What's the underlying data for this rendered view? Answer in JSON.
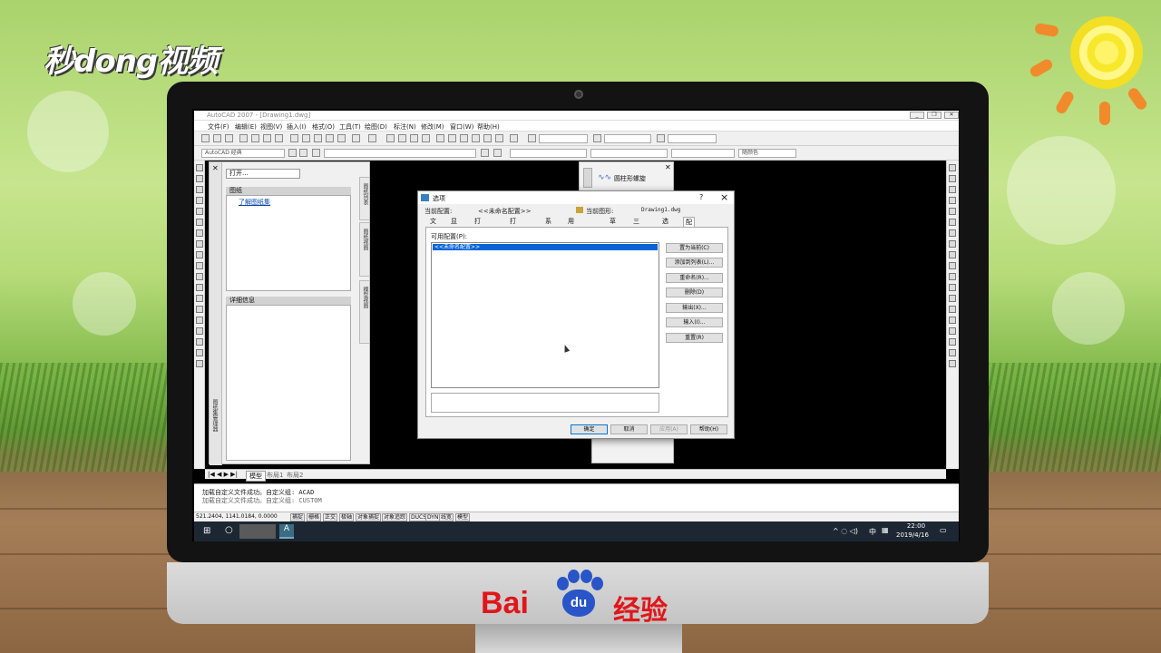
{
  "overlay": {
    "logo": "秒dong视频",
    "brand_en": "Bai",
    "brand_du": "du",
    "brand_cn": "经验"
  },
  "app": {
    "title": "AutoCAD 2007 - [Drawing1.dwg]",
    "menu": [
      "文件(F)",
      "编辑(E)",
      "视图(V)",
      "插入(I)",
      "格式(O)",
      "工具(T)",
      "绘图(D)",
      "标注(N)",
      "修改(M)",
      "窗口(W)",
      "帮助(H)"
    ],
    "workspace": "AutoCAD 经典",
    "bylayer_color": "随颜色"
  },
  "sheetset": {
    "open_combo": "打开...",
    "section1": "图纸",
    "link": "了解图纸集",
    "section2": "详细信息",
    "tab_list": "图纸列表",
    "tab_views": "图纸视图",
    "tab_model": "模型视图",
    "vertical_title": "图纸集管理器"
  },
  "tool_palette": {
    "item": "圆柱形螺旋"
  },
  "layout_tabs": [
    "模型",
    "布局1",
    "布局2"
  ],
  "command_line": {
    "line1": "加载自定义文件成功。自定义组: ACAD",
    "line2": "加载自定义文件成功。自定义组: CUSTOM"
  },
  "status": {
    "coords": "521.2404,  1141.0184, 0.0000",
    "toggles": [
      "捕捉",
      "栅格",
      "正交",
      "极轴",
      "对象捕捉",
      "对象追踪",
      "DUCS",
      "DYN",
      "线宽",
      "模型"
    ]
  },
  "taskbar": {
    "time": "22:00",
    "date": "2019/4/16",
    "ime": "中"
  },
  "dialog": {
    "title": "选项",
    "current_profile_label": "当前配置:",
    "current_profile_value": "<<未命名配置>>",
    "current_drawing_label": "当前图形:",
    "current_drawing_value": "Drawing1.dwg",
    "tabs": [
      "文件",
      "显示",
      "打开和保存",
      "打印和发布",
      "系统",
      "用户系统配置",
      "草图",
      "三维建模",
      "选择",
      "配置"
    ],
    "active_tab": "配置",
    "available_profiles_label": "可用配置(P):",
    "profiles": [
      "<<未命名配置>>"
    ],
    "side_buttons": [
      "置为当前(C)",
      "添加到列表(L)...",
      "重命名(R)...",
      "删除(D)",
      "输出(X)...",
      "输入(I)...",
      "重置(R)"
    ],
    "footer_buttons": [
      "确定",
      "取消",
      "应用(A)",
      "帮助(H)"
    ]
  },
  "colors": {
    "brand_red": "#e0161a",
    "brand_blue": "#2a55c8",
    "selection_blue": "#0a64d8"
  }
}
